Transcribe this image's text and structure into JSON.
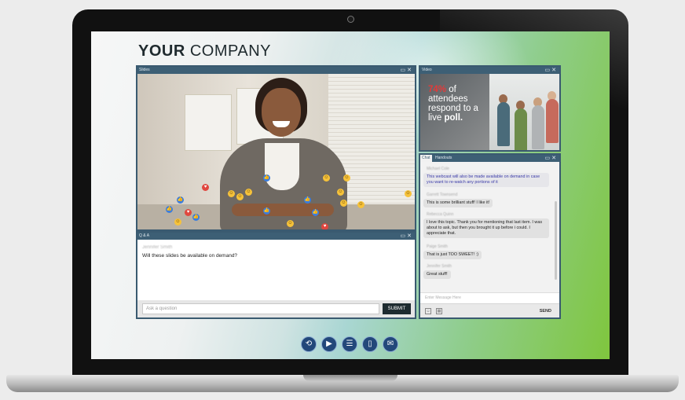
{
  "brand": {
    "bold": "YOUR",
    "rest": "COMPANY"
  },
  "panels": {
    "slides": {
      "title": "Slides"
    },
    "qa": {
      "title": "Q & A"
    },
    "video": {
      "title": "Video"
    },
    "chat": {
      "tabs": [
        "Chat",
        "Handouts"
      ]
    }
  },
  "qa": {
    "user": "Jennifer Smith",
    "question": "Will these slides be available on demand?",
    "input_placeholder": "Ask a question",
    "submit_label": "SUBMIT"
  },
  "video": {
    "stat": "74%",
    "line1": "of",
    "line2": "attendees",
    "line3": "respond to a",
    "line4_prefix": "live",
    "line4_bold": "poll."
  },
  "chat": {
    "messages": [
      {
        "name": "Michael Cole",
        "text": "This webcast will also be made available on demand in case you want to re-watch any portions of it",
        "highlight": true
      },
      {
        "name": "Garrett Townsend",
        "text": "This is some brilliant stuff! I like it!",
        "highlight": false
      },
      {
        "name": "Rebecca Quinn",
        "text": "I love this topic. Thank you for mentioning that last item. I was about to ask, but then you brought it up before i could. I appreciate that.",
        "highlight": false
      },
      {
        "name": "Paige Smith",
        "text": "That is just TOO SWEET! :)",
        "highlight": false
      },
      {
        "name": "Jennifer Smith",
        "text": "Great stuff!",
        "highlight": false
      }
    ],
    "input_placeholder": "Enter Message Here",
    "send_label": "SEND"
  },
  "dock": [
    "refresh-icon",
    "video-icon",
    "list-icon",
    "handout-icon",
    "chat-icon"
  ],
  "colors": {
    "panel_header": "#3d5f75",
    "dock_button": "#23487a",
    "stat_red": "#e23a39"
  }
}
